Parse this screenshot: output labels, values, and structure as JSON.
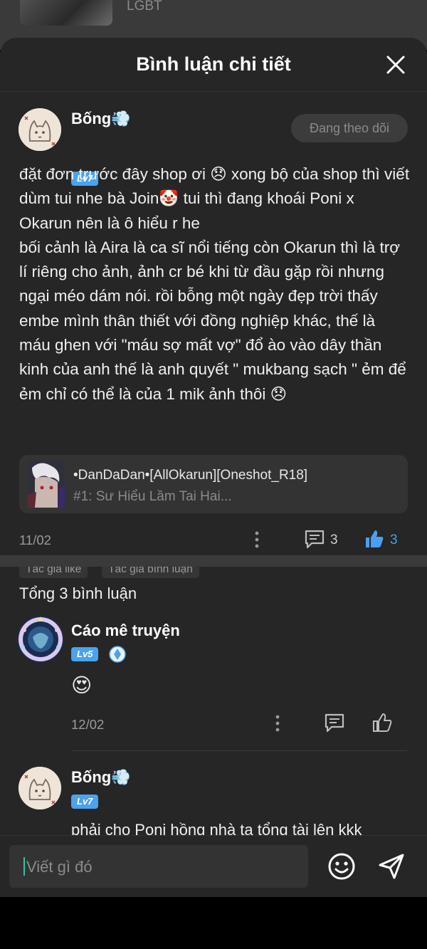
{
  "background": {
    "label": "LGBT"
  },
  "header": {
    "title": "Bình luận chi tiết"
  },
  "main_comment": {
    "username": "Bống💨",
    "level": "Lv7",
    "follow_label": "Đang theo dõi",
    "body": "đặt đơn trước đây shop ơi 😞 xong bộ của shop thì viết dùm tui nhe bà Join🤡 tui thì đang khoái Poni x Okarun nên là ô hiểu r he\nbối cảnh là Aira là ca sĩ nổi tiếng còn Okarun thì là trợ lí riêng cho ảnh, ảnh cr bé khi từ đầu gặp rồi nhưng ngại méo dám nói. rồi bỗng một ngày đẹp trời thấy embe mình thân thiết với đồng nghiệp khác, thế là máu ghen với \"máu sợ mất vợ\" đổ ào vào dây thần kinh của anh thế là anh quyết \" mukbang sạch \" ẻm để ẻm chỉ có thể là của 1 mik ảnh thôi 😞",
    "story": {
      "title": "•DanDaDan•[AllOkarun][Oneshot_R18]",
      "subtitle": "#1: Sư Hiểu Lầm Tai Hai..."
    },
    "date": "11/02",
    "comment_count": "3",
    "like_count": "3",
    "tags": [
      "Tác giả like",
      "Tác giả bình luận"
    ]
  },
  "replies_header": "Tổng 3 bình luận",
  "replies": [
    {
      "username": "Cáo mê truyện",
      "level": "Lv5",
      "body": "😍",
      "date": "12/02"
    },
    {
      "username": "Bống💨",
      "level": "Lv7",
      "body": "phải cho Poni hồng nhà ta tổng tài lên kkk"
    }
  ],
  "input": {
    "placeholder": "Viết gì đó"
  },
  "colors": {
    "sheet_bg": "#262626",
    "accent_blue": "#4aa3ec",
    "caret": "#2ec4a0"
  }
}
